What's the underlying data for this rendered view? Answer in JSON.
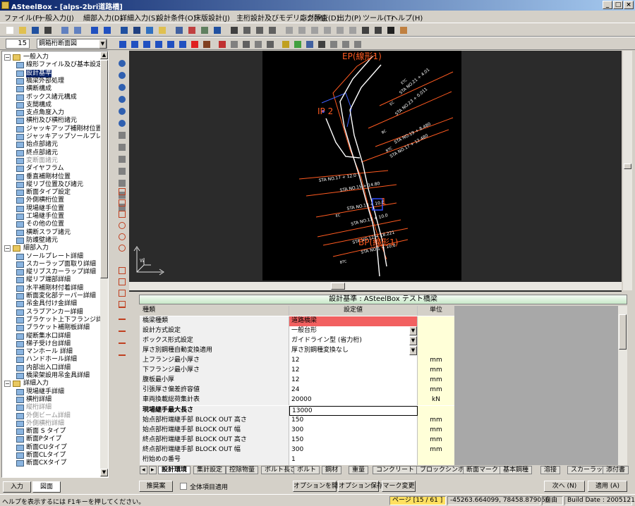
{
  "window": {
    "title": "ASteelBox - [alps-2bri道路橋]"
  },
  "menu": [
    "ファイル(F)",
    "一般入力(J)",
    "細部入力(D)",
    "詳細入力(S)",
    "設計条件(O)",
    "床版設計(J)",
    "主桁設計及びモデリング(M)",
    "応力照査(D)",
    "出力(P)",
    "ツール(T)",
    "ヘルプ(H)"
  ],
  "toolbar2": {
    "number": "15",
    "combo": "鋼箱桁断面図"
  },
  "tree": {
    "items": [
      {
        "level": 0,
        "label": "一般入力",
        "type": "folder"
      },
      {
        "level": 1,
        "label": "線形ファイル及び基本設定"
      },
      {
        "level": 1,
        "label": "設計基準"
      },
      {
        "level": 1,
        "label": "橋梁外部処理"
      },
      {
        "level": 1,
        "label": "横断構成"
      },
      {
        "level": 1,
        "label": "ボックス諸元構成"
      },
      {
        "level": 1,
        "label": "支間構成"
      },
      {
        "level": 1,
        "label": "支点角度入力"
      },
      {
        "level": 1,
        "label": "横桁及び横桁諸元"
      },
      {
        "level": 1,
        "label": "ジャッキアップ補剛材位置"
      },
      {
        "level": 1,
        "label": "ジャッキアップソールプレート諸"
      },
      {
        "level": 1,
        "label": "始点部諸元"
      },
      {
        "level": 1,
        "label": "終点部諸元"
      },
      {
        "level": 1,
        "label": "変断面諸元",
        "disabled": true
      },
      {
        "level": 1,
        "label": "ダイヤフラム"
      },
      {
        "level": 1,
        "label": "垂直補剛材位置"
      },
      {
        "level": 1,
        "label": "縦リブ位置及び諸元"
      },
      {
        "level": 1,
        "label": "断面タイプ設定"
      },
      {
        "level": 1,
        "label": "外側横桁位置"
      },
      {
        "level": 1,
        "label": "現場継手位置"
      },
      {
        "level": 1,
        "label": "工場継手位置"
      },
      {
        "level": 1,
        "label": "その他の位置"
      },
      {
        "level": 1,
        "label": "横断スラブ諸元"
      },
      {
        "level": 1,
        "label": "防護壁諸元"
      },
      {
        "level": 0,
        "label": "細部入力",
        "type": "folder"
      },
      {
        "level": 1,
        "label": "ソールプレート詳細"
      },
      {
        "level": 1,
        "label": "スカーラップ面取り詳細"
      },
      {
        "level": 1,
        "label": "縦リブスカーラップ詳細"
      },
      {
        "level": 1,
        "label": "縦リブ端部詳細"
      },
      {
        "level": 1,
        "label": "水平補剛材付着詳細"
      },
      {
        "level": 1,
        "label": "断面変化部テーパー詳細"
      },
      {
        "level": 1,
        "label": "吊金具付け金詳細"
      },
      {
        "level": 1,
        "label": "スラブアンカー詳細"
      },
      {
        "level": 1,
        "label": "ブラケット上下フランジ詳細"
      },
      {
        "level": 1,
        "label": "ブラケット補剛板詳細"
      },
      {
        "level": 1,
        "label": "縦断集水口詳細"
      },
      {
        "level": 1,
        "label": "梯子受け台詳細"
      },
      {
        "level": 1,
        "label": "マンホール 詳細"
      },
      {
        "level": 1,
        "label": "ハンドホール詳細"
      },
      {
        "level": 1,
        "label": "内部出入口詳細"
      },
      {
        "level": 1,
        "label": "橋梁架設用吊金具詳細"
      },
      {
        "level": 0,
        "label": "詳細入力",
        "type": "folder"
      },
      {
        "level": 1,
        "label": "現場継手詳細"
      },
      {
        "level": 1,
        "label": "横桁詳細"
      },
      {
        "level": 1,
        "label": "縦桁詳細",
        "disabled": true
      },
      {
        "level": 1,
        "label": "外側ビーム詳細",
        "disabled": true
      },
      {
        "level": 1,
        "label": "外側横桁詳細",
        "disabled": true
      },
      {
        "level": 1,
        "label": "断面 S タイプ"
      },
      {
        "level": 1,
        "label": "断面Pタイプ"
      },
      {
        "level": 1,
        "label": "断面CUタイプ"
      },
      {
        "level": 1,
        "label": "断面CLタイプ"
      },
      {
        "level": 1,
        "label": "断面CXタイプ"
      }
    ]
  },
  "tree_tabs": {
    "input": "入力",
    "drawing": "図面"
  },
  "viewer": {
    "labels": [
      "EP(線形1)",
      "IP 2",
      "1",
      "BP(線形1)"
    ],
    "stations": [
      "STA NO.21 + 4.01",
      "STA NO.23 + 0.011",
      "STA NO.19 + 8.480",
      "STA NO.17 + 12.480",
      "STA NO.15 + 14.80",
      "STA NO.13 + 10.0",
      "STA NO.13 + 10.0",
      "STA NO.12 + 18.221",
      "STA NO.17 + 12.0",
      "STA NO.1 + 10.0"
    ],
    "codes": [
      "ETC",
      "EC",
      "BC",
      "BTC",
      "EC",
      "BTC"
    ]
  },
  "panel": {
    "title": "設計基準 : ASteelBox テスト橋梁"
  },
  "grid": {
    "headers": [
      "種類",
      "設定値",
      "単位"
    ],
    "rows": [
      {
        "label": "橋梁種類",
        "value": "道路橋梁",
        "unit": "",
        "style": "red"
      },
      {
        "label": "設計方式設定",
        "value": "一般台形",
        "unit": "",
        "dropdown": true
      },
      {
        "label": "ボックス形式設定",
        "value": "ガイドライン型 (省力桁)",
        "unit": "",
        "dropdown": true
      },
      {
        "label": "厚さ別鋼種自動変換適用",
        "value": "厚さ別鋼種変換なし",
        "unit": "",
        "dropdown": true
      },
      {
        "label": "上フランジ最小厚さ",
        "value": "12",
        "unit": "mm"
      },
      {
        "label": "下フランジ最小厚さ",
        "value": "12",
        "unit": "mm"
      },
      {
        "label": "腹板最小厚",
        "value": "12",
        "unit": "mm"
      },
      {
        "label": "引張厚さ偏差許容値",
        "value": "24",
        "unit": "mm"
      },
      {
        "label": "車両換載総荷集計表",
        "value": "20000",
        "unit": "kN"
      },
      {
        "label": "現場継手最大長さ",
        "value": "13000",
        "unit": "",
        "style": "edit"
      },
      {
        "label": "始点部桁端継手部 BLOCK OUT 高さ",
        "value": "150",
        "unit": "mm"
      },
      {
        "label": "始点部桁端継手部 BLOCK OUT 幅",
        "value": "300",
        "unit": "mm"
      },
      {
        "label": "終点部桁端継手部 BLOCK OUT 高さ",
        "value": "150",
        "unit": "mm"
      },
      {
        "label": "終点部桁端継手部 BLOCK OUT 幅",
        "value": "300",
        "unit": "mm"
      },
      {
        "label": "桁始めの番号",
        "value": "1",
        "unit": ""
      }
    ]
  },
  "tabs": [
    "設計環境",
    "集計設定",
    "控除物量",
    "ボルト長さ",
    "ボルト",
    "鋼材",
    "重量",
    "コンクリート",
    "ブロックシンボル",
    "断面マーク",
    "基本鋼種",
    "溶接",
    "スカーラップ",
    "添付書"
  ],
  "bottom": {
    "recommend": "推奨案",
    "all_items": "全体項目適用",
    "option_open": "オプションを開く",
    "option_save": "オプション保存",
    "mark_change": "マーク変更",
    "next": "次へ (N)",
    "apply": "適用 (A)"
  },
  "status": {
    "help": "ヘルプを表示するには F1キーを押してください。",
    "page": "ページ [15 / 61 ]",
    "coords": "-45263.664099,  78458.879056",
    "mode": "自由",
    "build": "Build Date : 20051212"
  }
}
